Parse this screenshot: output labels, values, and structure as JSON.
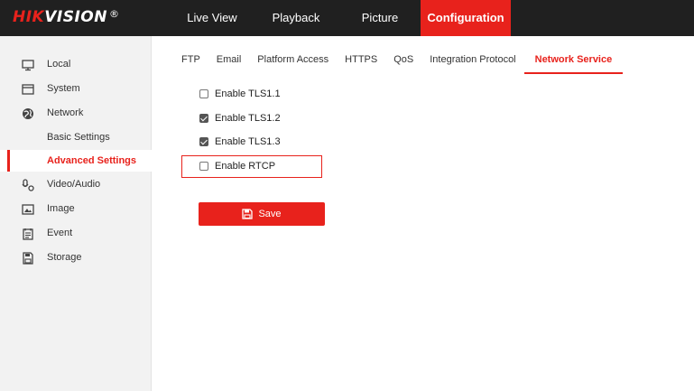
{
  "logo": {
    "brand_red": "HIK",
    "brand_white": "VISION",
    "mark": "®"
  },
  "nav": {
    "live_view": "Live View",
    "playback": "Playback",
    "picture": "Picture",
    "configuration": "Configuration"
  },
  "sidebar": {
    "items": [
      {
        "label": "Local",
        "icon": "monitor-icon"
      },
      {
        "label": "System",
        "icon": "system-icon"
      },
      {
        "label": "Network",
        "icon": "globe-icon"
      },
      {
        "label": "Basic Settings"
      },
      {
        "label": "Advanced Settings",
        "active": true
      },
      {
        "label": "Video/Audio",
        "icon": "video-audio-icon"
      },
      {
        "label": "Image",
        "icon": "image-icon"
      },
      {
        "label": "Event",
        "icon": "event-icon"
      },
      {
        "label": "Storage",
        "icon": "storage-icon"
      }
    ]
  },
  "tabs": [
    "FTP",
    "Email",
    "Platform Access",
    "HTTPS",
    "QoS",
    "Integration Protocol",
    "Network Service"
  ],
  "active_tab": "Network Service",
  "options": [
    {
      "label": "Enable TLS1.1",
      "checked": false
    },
    {
      "label": "Enable TLS1.2",
      "checked": true
    },
    {
      "label": "Enable TLS1.3",
      "checked": true
    },
    {
      "label": "Enable RTCP",
      "checked": false,
      "highlighted": true
    }
  ],
  "save_label": "Save",
  "colors": {
    "accent": "#e8221c",
    "topbar": "#202020",
    "sidebar": "#f2f2f2"
  }
}
